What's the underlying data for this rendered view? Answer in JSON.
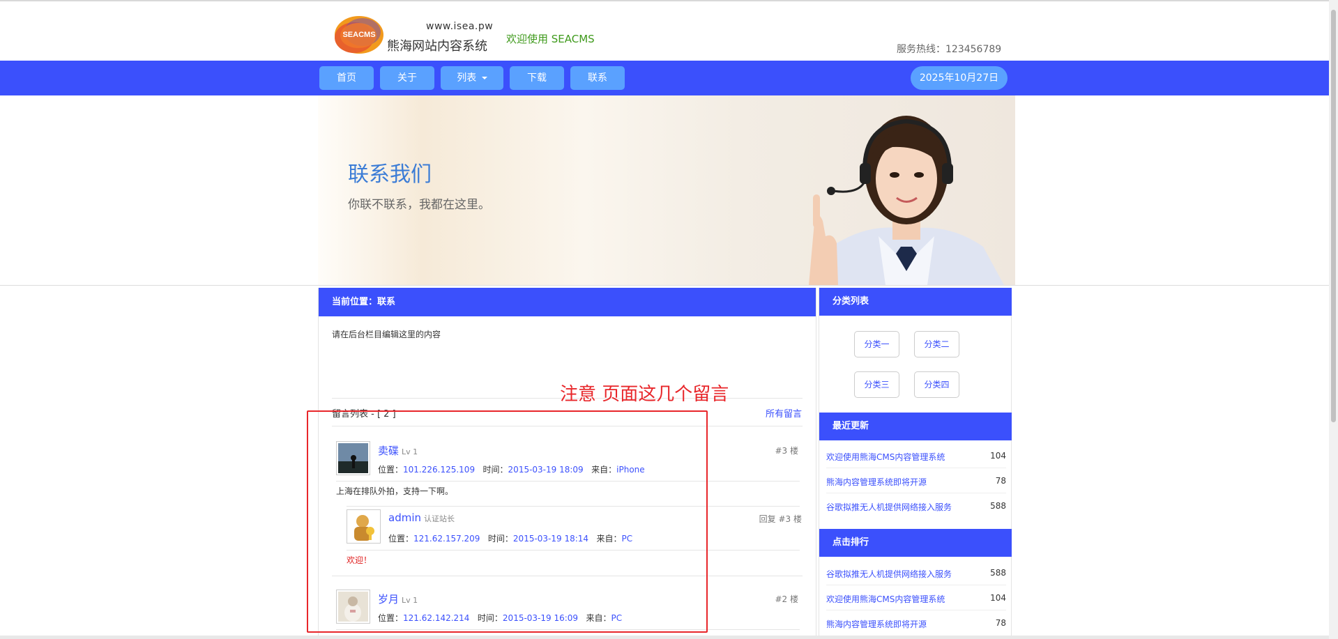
{
  "site": {
    "logo_text": "SEACMS",
    "url": "www.isea.pw",
    "name": "熊海网站内容系统",
    "welcome": "欢迎使用 SEACMS",
    "hotline": "服务热线：123456789"
  },
  "nav": {
    "items": [
      {
        "label": "首页"
      },
      {
        "label": "关于"
      },
      {
        "label": "列表"
      },
      {
        "label": "下载"
      },
      {
        "label": "联系"
      }
    ],
    "date": "2025年10月27日"
  },
  "banner": {
    "title": "联系我们",
    "subtitle": "你联不联系，我都在这里。"
  },
  "main": {
    "breadcrumb": "当前位置：联系",
    "content": "请在后台栏目编辑这里的内容",
    "comments_header": "留言列表 - [ 2 ]",
    "all_comments": "所有留言",
    "comments": [
      {
        "user": "卖碟",
        "level": "Lv 1",
        "floor": "#3 楼",
        "loc_label": "位置：",
        "loc": "101.226.125.109",
        "time_label": "时间：",
        "time": "2015-03-19 18:09",
        "from_label": "来自：",
        "from": "iPhone",
        "text": "上海在排队外拍，支持一下啊。",
        "reply": {
          "user": "admin",
          "badge": "认证站长",
          "floor": "回复 #3 楼",
          "loc_label": "位置：",
          "loc": "121.62.157.209",
          "time_label": "时间：",
          "time": "2015-03-19 18:14",
          "from_label": "来自：",
          "from": "PC",
          "text": "欢迎！"
        }
      },
      {
        "user": "岁月",
        "level": "Lv 1",
        "floor": "#2 楼",
        "loc_label": "位置：",
        "loc": "121.62.142.214",
        "time_label": "时间：",
        "time": "2015-03-19 16:09",
        "from_label": "来自：",
        "from": "PC"
      }
    ]
  },
  "annotation": {
    "text": "注意 页面这几个留言",
    "color": "#e8262a"
  },
  "sidebar": {
    "categories_title": "分类列表",
    "categories": [
      "分类一",
      "分类二",
      "分类三",
      "分类四"
    ],
    "recent_title": "最近更新",
    "recent": [
      {
        "title": "欢迎使用熊海CMS内容管理系统",
        "count": "104"
      },
      {
        "title": "熊海内容管理系统即将开源",
        "count": "78"
      },
      {
        "title": "谷歌拟推无人机提供网络接入服务",
        "count": "588"
      }
    ],
    "rank_title": "点击排行",
    "rank": [
      {
        "title": "谷歌拟推无人机提供网络接入服务",
        "count": "588"
      },
      {
        "title": "欢迎使用熊海CMS内容管理系统",
        "count": "104"
      },
      {
        "title": "熊海内容管理系统即将开源",
        "count": "78"
      }
    ]
  },
  "colors": {
    "nav": "#3b50fc",
    "nav_button": "#5aa1ff",
    "link": "#3b50fc",
    "welcome": "#3f9a1c"
  }
}
